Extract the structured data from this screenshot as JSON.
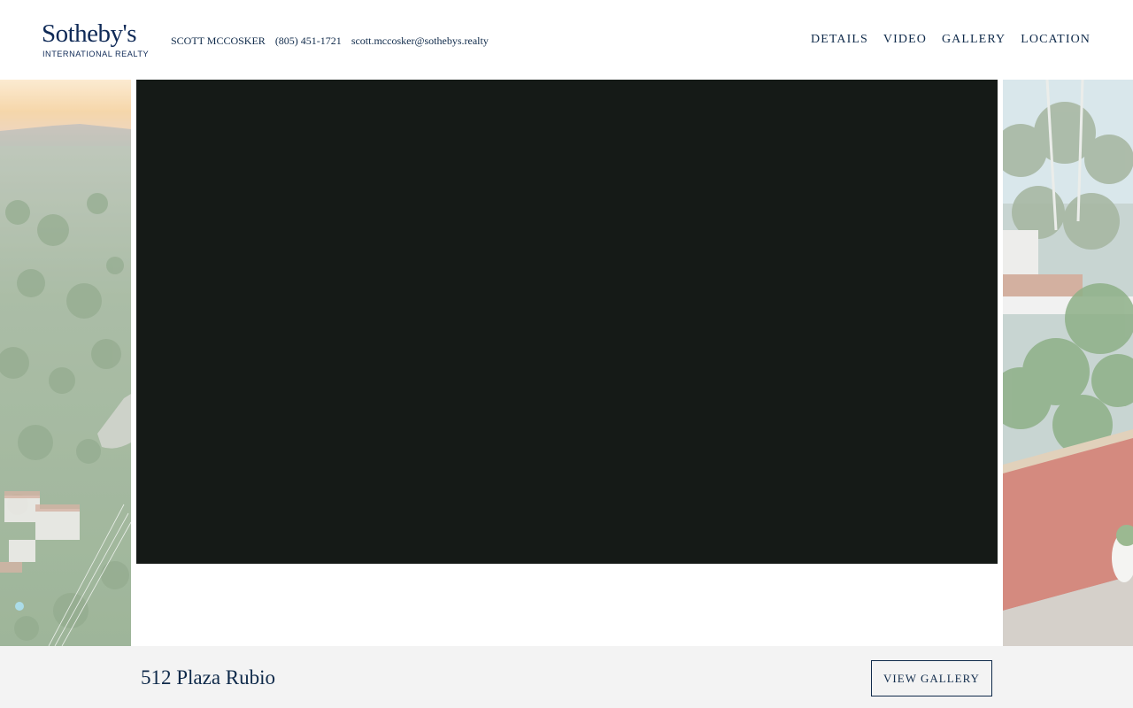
{
  "brand": {
    "name": "Sotheby's",
    "subtitle": "INTERNATIONAL REALTY"
  },
  "agent": {
    "name": "SCOTT MCCOSKER",
    "phone": "(805) 451-1721",
    "email": "scott.mccosker@sothebys.realty"
  },
  "nav": {
    "items": [
      {
        "label": "DETAILS"
      },
      {
        "label": "VIDEO"
      },
      {
        "label": "GALLERY"
      },
      {
        "label": "LOCATION"
      }
    ]
  },
  "listing": {
    "address": "512 Plaza Rubio",
    "gallery_button": "VIEW GALLERY"
  },
  "colors": {
    "brand_navy": "#0f2a4a",
    "video_background": "#151a17",
    "footer_background": "#f3f3f3"
  }
}
